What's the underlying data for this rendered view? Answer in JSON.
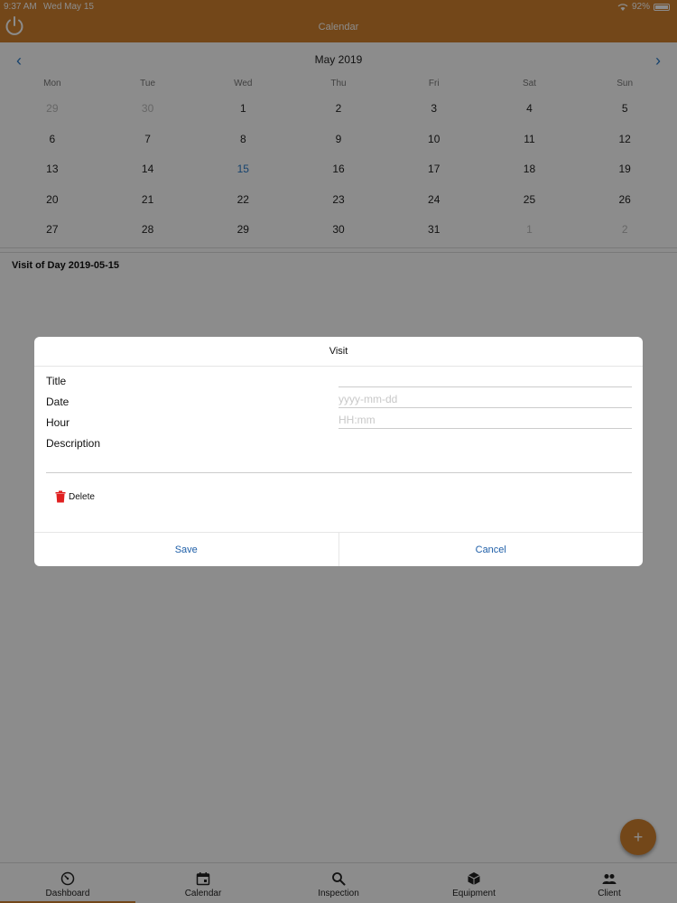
{
  "status_bar": {
    "time": "9:37 AM",
    "date": "Wed May 15",
    "battery": "92%"
  },
  "header": {
    "title": "Calendar"
  },
  "calendar": {
    "month_label": "May 2019",
    "weekdays": [
      "Mon",
      "Tue",
      "Wed",
      "Thu",
      "Fri",
      "Sat",
      "Sun"
    ],
    "weeks": [
      [
        "29",
        "30",
        "1",
        "2",
        "3",
        "4",
        "5"
      ],
      [
        "6",
        "7",
        "8",
        "9",
        "10",
        "11",
        "12"
      ],
      [
        "13",
        "14",
        "15",
        "16",
        "17",
        "18",
        "19"
      ],
      [
        "20",
        "21",
        "22",
        "23",
        "24",
        "25",
        "26"
      ],
      [
        "27",
        "28",
        "29",
        "30",
        "31",
        "1",
        "2"
      ]
    ],
    "selected_day": "15"
  },
  "visits": {
    "title": "Visit of Day 2019-05-15"
  },
  "dialog": {
    "title": "Visit",
    "fields": {
      "title_label": "Title",
      "date_label": "Date",
      "date_placeholder": "yyyy-mm-dd",
      "hour_label": "Hour",
      "hour_placeholder": "HH:mm",
      "description_label": "Description"
    },
    "delete_label": "Delete",
    "save_label": "Save",
    "cancel_label": "Cancel"
  },
  "fab": {
    "label": "+"
  },
  "tabbar": {
    "tabs": [
      {
        "label": "Dashboard",
        "icon": "dashboard-icon"
      },
      {
        "label": "Calendar",
        "icon": "calendar-icon"
      },
      {
        "label": "Inspection",
        "icon": "search-icon"
      },
      {
        "label": "Equipment",
        "icon": "cube-icon"
      },
      {
        "label": "Client",
        "icon": "people-icon"
      }
    ],
    "active_index": 0
  },
  "colors": {
    "accent": "#d2822e",
    "link": "#2b7bc8",
    "delete": "#e02020"
  }
}
